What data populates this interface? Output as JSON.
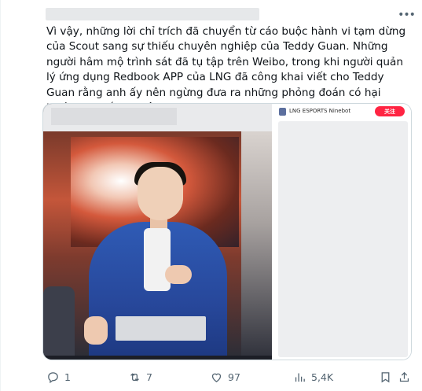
{
  "tweet": {
    "text": "Vì vậy, những lời chỉ trích đã chuyển từ cáo buộc hành vi tạm dừng của Scout sang sự thiếu chuyên nghiệp của Teddy Guan. Những người hâm mộ trình sát đã tụ tập trên Weibo, trong khi người quản lý ứng dụng Redbook APP của LNG đã công khai viết cho Teddy Guan rằng anh ấy nên ngừng đưa ra những phỏng đoán có hại trước khi biết sự thật.",
    "more_icon": "more-dots-icon"
  },
  "media": {
    "right_panel": {
      "account_name": "LNG ESPORTS Ninebot",
      "badge_label": "关注",
      "badge_color": "#ff2442"
    }
  },
  "actions": {
    "reply_count": "1",
    "repost_count": "7",
    "like_count": "97",
    "views_count": "5,4K",
    "icon_color": "#536471"
  }
}
